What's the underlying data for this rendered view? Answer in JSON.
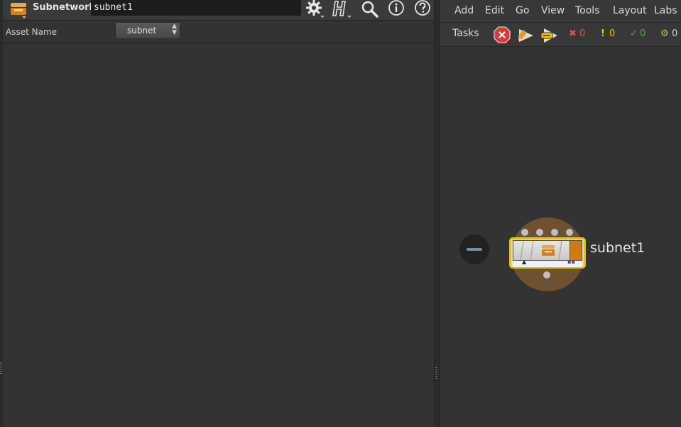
{
  "parameter_pane": {
    "node_type_label": "Subnetwork",
    "node_name_value": "subnet1",
    "toolbar_icons": [
      "gear-icon",
      "houdini-h-icon",
      "search-icon",
      "info-icon",
      "help-icon"
    ],
    "asset_name": {
      "label": "Asset Name",
      "selected": "subnet"
    }
  },
  "network_pane": {
    "menu": [
      "Add",
      "Edit",
      "Go",
      "View",
      "Tools",
      "Layout",
      "Labs"
    ],
    "tasks": {
      "label": "Tasks",
      "error_count": "0",
      "warning_count": "0",
      "success_count": "0",
      "pending_count": "0"
    },
    "node": {
      "name": "subnet1"
    }
  },
  "colors": {
    "background": "#333333",
    "selection_outline": "#e9c300",
    "node_flag": "#d07a10",
    "node_ring": "#6e5131",
    "error": "#e05050",
    "warning": "#e6c200",
    "success": "#5aa04a"
  }
}
